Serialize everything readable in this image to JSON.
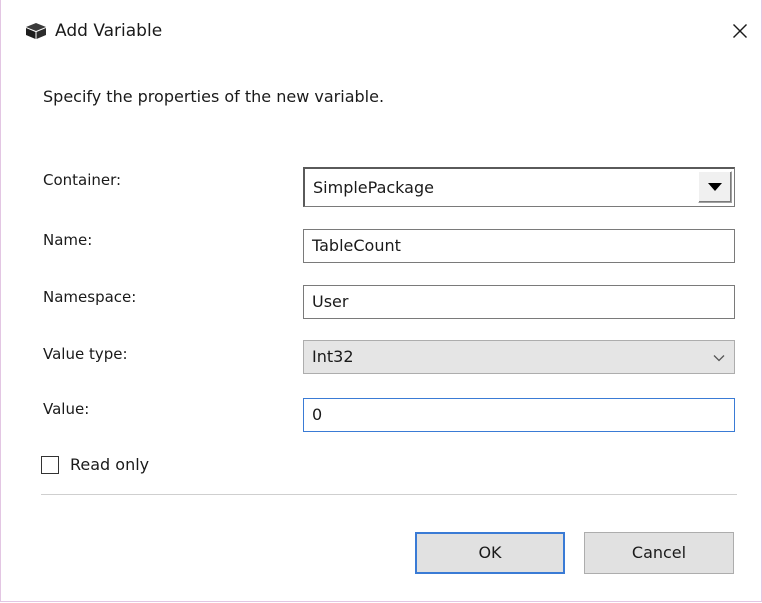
{
  "dialog": {
    "title": "Add Variable",
    "title_icon": "package-cube-icon",
    "close_glyph": "✕",
    "instruction": "Specify the properties of the new variable."
  },
  "fields": {
    "container_label": "Container:",
    "container_value": "SimplePackage",
    "name_label": "Name:",
    "name_value": "TableCount",
    "namespace_label": "Namespace:",
    "namespace_value": "User",
    "value_type_label": "Value type:",
    "value_type_value": "Int32",
    "value_label": "Value:",
    "value_value": "0"
  },
  "read_only": {
    "label": "Read only",
    "checked": false
  },
  "buttons": {
    "ok_label": "OK",
    "cancel_label": "Cancel"
  },
  "colors": {
    "focus_accent": "#3a7bd5",
    "window_border": "#e3c6e3"
  }
}
